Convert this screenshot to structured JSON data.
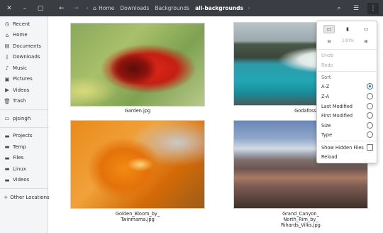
{
  "header": {
    "window_controls": [
      "close-icon",
      "minimize-icon",
      "maximize-icon"
    ],
    "back_icon": "back-arrow-icon",
    "forward_icon": "forward-arrow-icon",
    "path_left_icon": "chevron-left-icon",
    "breadcrumbs": [
      {
        "label": "Home",
        "icon": "home-icon"
      },
      {
        "label": "Downloads"
      },
      {
        "label": "Backgrounds"
      },
      {
        "label": "all-backgrounds",
        "active": true
      }
    ],
    "path_right_icon": "chevron-right-icon",
    "right_icons": [
      "search-icon",
      "view-toggle-icon",
      "menu-icon"
    ]
  },
  "sidebar": {
    "items": [
      {
        "label": "Recent",
        "icon": "clock-icon"
      },
      {
        "label": "Home",
        "icon": "home-icon"
      },
      {
        "label": "Documents",
        "icon": "document-icon"
      },
      {
        "label": "Downloads",
        "icon": "download-icon"
      },
      {
        "label": "Music",
        "icon": "music-icon"
      },
      {
        "label": "Pictures",
        "icon": "picture-icon"
      },
      {
        "label": "Videos",
        "icon": "video-icon"
      },
      {
        "label": "Trash",
        "icon": "trash-icon"
      }
    ],
    "bookmarks": [
      {
        "label": "pjsingh",
        "icon": "bookmark-icon"
      }
    ],
    "folders": [
      {
        "label": "Projects",
        "icon": "folder-icon"
      },
      {
        "label": "Temp",
        "icon": "folder-icon"
      },
      {
        "label": "Files",
        "icon": "folder-icon"
      },
      {
        "label": "Linux",
        "icon": "folder-icon"
      },
      {
        "label": "Videos",
        "icon": "folder-icon"
      }
    ],
    "other_locations": {
      "label": "Other Locations",
      "icon": "plus-icon"
    }
  },
  "files": [
    {
      "name": "Garden.jpg"
    },
    {
      "name": "Godafoss_Iceland"
    },
    {
      "name_line1": "Golden_Bloom_by_",
      "name_line2": "Twinmama.jpg"
    },
    {
      "name_line1": "Grand_Canyon_",
      "name_line2": "North_Rim_by_",
      "name_line3": "Rihards_Vilks.jpg"
    }
  ],
  "menu": {
    "top_icons": [
      "new-folder-icon",
      "bookmark-icon",
      "open-terminal-icon"
    ],
    "zoom_out_icon": "zoom-out-icon",
    "zoom_level": "100%",
    "zoom_in_icon": "zoom-in-icon",
    "undo": "Undo",
    "redo": "Redo",
    "sort_heading": "Sort",
    "sort_options": [
      {
        "label": "A-Z",
        "checked": true
      },
      {
        "label": "Z-A",
        "checked": false
      },
      {
        "label": "Last Modified",
        "checked": false
      },
      {
        "label": "First Modified",
        "checked": false
      },
      {
        "label": "Size",
        "checked": false
      },
      {
        "label": "Type",
        "checked": false
      }
    ],
    "show_hidden": "Show Hidden Files",
    "reload": "Reload"
  }
}
